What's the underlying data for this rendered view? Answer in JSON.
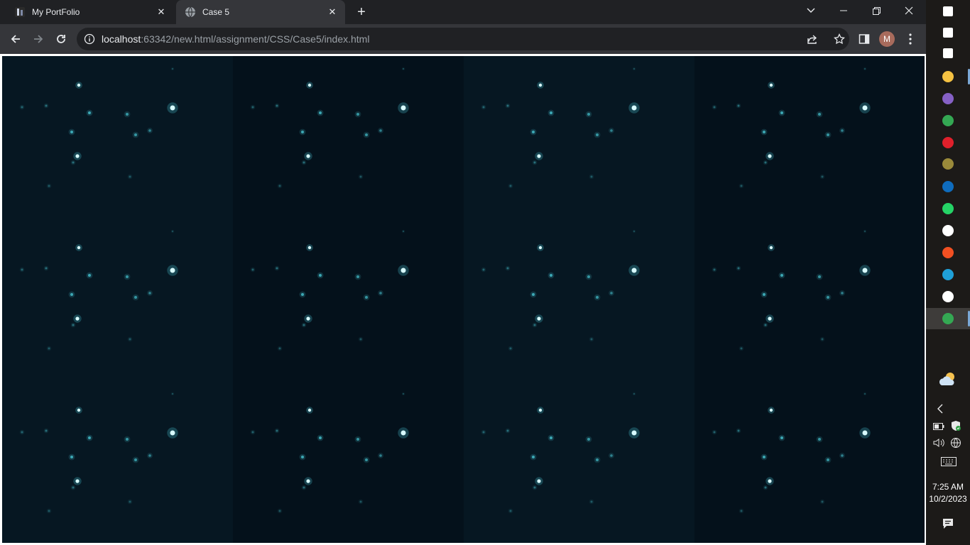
{
  "browser": {
    "tabs": [
      {
        "title": "My PortFolio",
        "active": false,
        "favicon": "portfolio-favicon",
        "close": "✕"
      },
      {
        "title": "Case 5",
        "active": true,
        "favicon": "globe-icon",
        "close": "✕"
      }
    ],
    "new_tab": "+",
    "window_controls": {
      "tab_search": "chevron-down-icon",
      "minimize": "minimize-icon",
      "restore": "restore-icon",
      "close": "close-icon"
    },
    "toolbar": {
      "back": "back-arrow-icon",
      "forward": "forward-arrow-icon",
      "reload": "reload-icon",
      "url_host": "localhost",
      "url_rest": ":63342/new.html/assignment/CSS/Case5/index.html",
      "share": "share-icon",
      "bookmark": "star-icon",
      "side_panel": "side-panel-icon",
      "profile_initial": "M",
      "menu": "kebab-menu-icon"
    }
  },
  "page": {
    "background": "#031019",
    "tile_grid": {
      "columns": 4,
      "rows": 3
    },
    "star_color": "#4fd8e6"
  },
  "taskbar": {
    "apps": [
      {
        "name": "windows-start-icon",
        "color": "#ffffff"
      },
      {
        "name": "search-icon",
        "color": "#ffffff"
      },
      {
        "name": "task-view-icon",
        "color": "#ffffff"
      },
      {
        "name": "file-explorer-icon",
        "color": "#f5c242"
      },
      {
        "name": "visual-studio-icon",
        "color": "#8661c5"
      },
      {
        "name": "chrome-icon",
        "color": "#34a853"
      },
      {
        "name": "opera-icon",
        "color": "#e0202b"
      },
      {
        "name": "chrome-canary-icon",
        "color": "#9a8a3a"
      },
      {
        "name": "mail-icon",
        "color": "#0f6cbd"
      },
      {
        "name": "whatsapp-icon",
        "color": "#25d366"
      },
      {
        "name": "github-icon",
        "color": "#ffffff"
      },
      {
        "name": "microsoft-store-icon",
        "color": "#f25022"
      },
      {
        "name": "edge-icon",
        "color": "#1fa0d8"
      },
      {
        "name": "intellij-icon",
        "color": "#ffffff"
      },
      {
        "name": "chrome-active-icon",
        "color": "#34a853"
      }
    ],
    "weather_icon": "partly-cloudy-night-icon",
    "time": "7:25 AM",
    "date": "10/2/2023",
    "notifications_icon": "notification-icon"
  }
}
